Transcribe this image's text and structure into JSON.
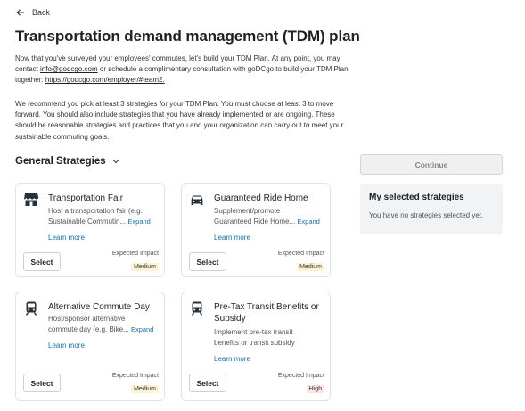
{
  "nav": {
    "back_label": "Back"
  },
  "page": {
    "title": "Transportation demand management (TDM) plan",
    "intro_1": "Now that you've surveyed your employees' commutes, let's build your TDM Plan. At any point, you may contact",
    "contact_email": "info@godcgo.com",
    "intro_2": "or schedule a complimentary consultation with goDCgo to build your TDM Plan together:",
    "team_link": "https://godcgo.com/employer/#team2.",
    "recommendation": "We recommend you pick at least 3 strategies for your TDM Plan. You must choose at least 3 to move forward. You should also include strategies that you have already implemented or are ongoing. These should be reasonable strategies and practices that you and your organization can carry out to meet your sustainable commuting goals."
  },
  "section": {
    "title": "General Strategies"
  },
  "strategies": [
    {
      "title": "Transportation Fair",
      "desc_line1": "Host a transportation fair (e.g.",
      "desc_line2": "Sustainable Commutin...",
      "expand": "Expand",
      "learn_more": "Learn more",
      "select": "Select",
      "impact_label": "Expected Impact",
      "impact": "Medium",
      "icon": "store-icon"
    },
    {
      "title": "Guaranteed Ride Home",
      "desc_line1": "Supplement/promote",
      "desc_line2": "Guaranteed Ride Home...",
      "expand": "Expand",
      "learn_more": "Learn more",
      "select": "Select",
      "impact_label": "Expected Impact",
      "impact": "Medium",
      "icon": "car-icon"
    },
    {
      "title": "Alternative Commute Day",
      "desc_line1": "Host/sponsor alternative",
      "desc_line2": "commute day (e.g. Bike...",
      "expand": "Expand",
      "learn_more": "Learn more",
      "select": "Select",
      "impact_label": "Expected Impact",
      "impact": "Medium",
      "icon": "train-icon"
    },
    {
      "title": "Pre-Tax Transit Benefits or Subsidy",
      "desc_line1": "Implement pre-tax transit",
      "desc_line2": "benefits or transit subsidy",
      "learn_more": "Learn more",
      "select": "Select",
      "impact_label": "Expected Impact",
      "impact": "High",
      "icon": "train-icon"
    }
  ],
  "sidebar": {
    "continue_label": "Continue",
    "selected_title": "My selected strategies",
    "selected_empty": "You have no strategies selected yet."
  },
  "colors": {
    "link": "#1a6fa3",
    "medium_badge_bg": "#fdf3d4",
    "high_badge_bg": "#fde3e3",
    "panel_bg": "#f1f3f5"
  }
}
